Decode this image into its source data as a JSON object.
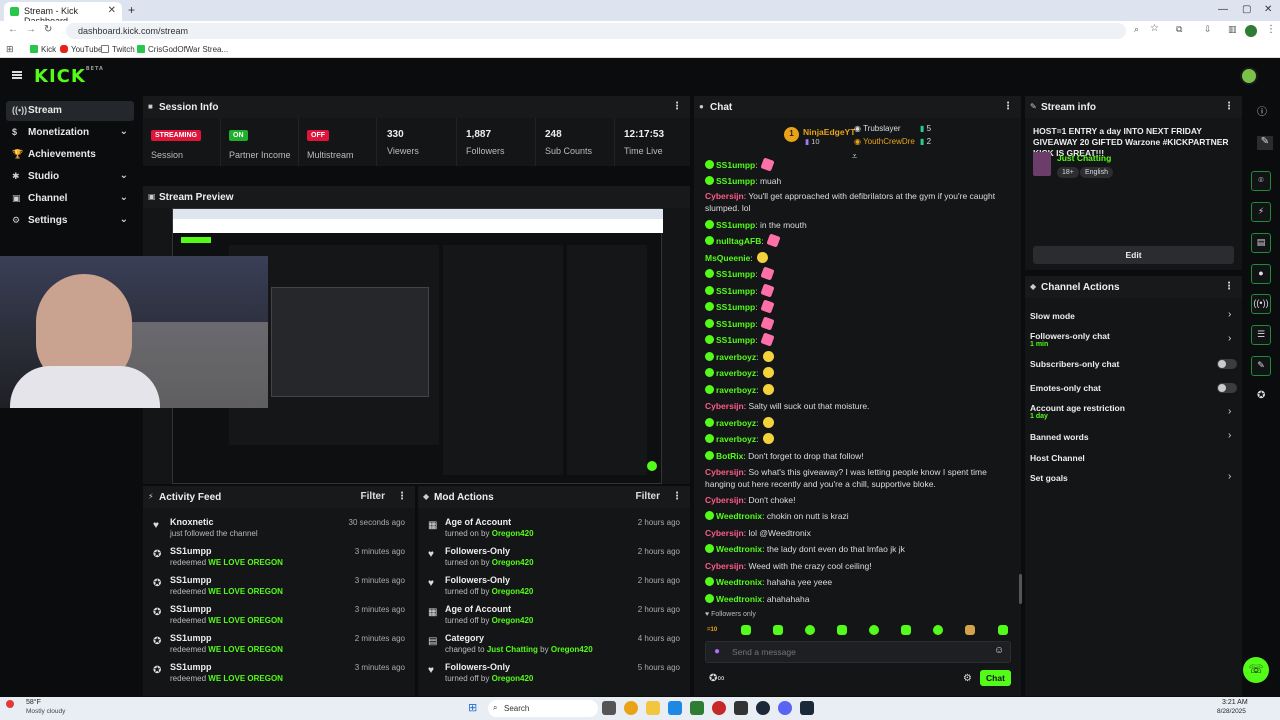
{
  "browser": {
    "tab_title": "Stream - Kick Dashboard",
    "new_tab": "+",
    "url": "dashboard.kick.com/stream",
    "bookmarks": [
      "Kick",
      "YouTube",
      "Twitch",
      "CrisGodOfWar Strea..."
    ]
  },
  "brand": {
    "logo": "KICK",
    "logo_sup": "BETA",
    "accent": "#53fc18"
  },
  "sidebar": {
    "items": [
      {
        "label": "Stream",
        "icon": "stream-icon",
        "active": true
      },
      {
        "label": "Monetization",
        "icon": "dollar-icon"
      },
      {
        "label": "Achievements",
        "icon": "trophy-icon"
      },
      {
        "label": "Studio",
        "icon": "studio-icon"
      },
      {
        "label": "Channel",
        "icon": "channel-icon"
      },
      {
        "label": "Settings",
        "icon": "gear-icon"
      }
    ]
  },
  "session": {
    "title": "Session Info",
    "stats": [
      {
        "badge": "STREAMING",
        "label": "Session",
        "color": "#e0133a"
      },
      {
        "badge": "ON",
        "label": "Partner Income",
        "color": "#1fae2e"
      },
      {
        "badge": "OFF",
        "label": "Multistream",
        "color": "#e0133a"
      },
      {
        "value": "330",
        "label": "Viewers"
      },
      {
        "value": "1,887",
        "label": "Followers"
      },
      {
        "value": "248",
        "label": "Sub Counts"
      },
      {
        "value": "12:17:53",
        "label": "Time Live"
      }
    ]
  },
  "preview": {
    "title": "Stream Preview"
  },
  "activity": {
    "title": "Activity Feed",
    "filter": "Filter",
    "rows": [
      {
        "user": "Knoxnetic",
        "detail": "just followed the channel",
        "time": "30 seconds ago",
        "icon": "heart-icon"
      },
      {
        "user": "SS1umpp",
        "detail_pre": "redeemed",
        "reward": "WE LOVE OREGON",
        "time": "3 minutes ago",
        "icon": "reward-icon"
      },
      {
        "user": "SS1umpp",
        "detail_pre": "redeemed",
        "reward": "WE LOVE OREGON",
        "time": "3 minutes ago",
        "icon": "reward-icon"
      },
      {
        "user": "SS1umpp",
        "detail_pre": "redeemed",
        "reward": "WE LOVE OREGON",
        "time": "3 minutes ago",
        "icon": "reward-icon"
      },
      {
        "user": "SS1umpp",
        "detail_pre": "redeemed",
        "reward": "WE LOVE OREGON",
        "time": "2 minutes ago",
        "icon": "reward-icon"
      },
      {
        "user": "SS1umpp",
        "detail_pre": "redeemed",
        "reward": "WE LOVE OREGON",
        "time": "3 minutes ago",
        "icon": "reward-icon"
      }
    ]
  },
  "mod": {
    "title": "Mod Actions",
    "filter": "Filter",
    "rows": [
      {
        "action": "Age of Account",
        "pre": "turned on by",
        "by": "Oregon420",
        "time": "2 hours ago",
        "icon": "calendar-icon"
      },
      {
        "action": "Followers-Only",
        "pre": "turned on by",
        "by": "Oregon420",
        "time": "2 hours ago",
        "icon": "heart-icon"
      },
      {
        "action": "Followers-Only",
        "pre": "turned off by",
        "by": "Oregon420",
        "time": "2 hours ago",
        "icon": "heart-icon"
      },
      {
        "action": "Age of Account",
        "pre": "turned off by",
        "by": "Oregon420",
        "time": "2 hours ago",
        "icon": "calendar-icon"
      },
      {
        "action": "Category",
        "pre": "changed to",
        "mid": "Just Chatting",
        "pre2": "by",
        "by": "Oregon420",
        "time": "4 hours ago",
        "icon": "category-icon"
      },
      {
        "action": "Followers-Only",
        "pre": "turned off by",
        "by": "Oregon420",
        "time": "5 hours ago",
        "icon": "heart-icon"
      }
    ]
  },
  "chat": {
    "title": "Chat",
    "top_gifter": {
      "name": "NinjaEdgeYT",
      "count": "10",
      "rank": "1"
    },
    "others": [
      {
        "name": "Trubslayer",
        "count": "5"
      },
      {
        "name": "YouthCrewDre",
        "count": "2"
      }
    ],
    "messages": [
      {
        "user": "SS1umpp",
        "text": "",
        "color": "#53fc18",
        "badge": true,
        "emote": "pink"
      },
      {
        "user": "SS1umpp",
        "text": "muah",
        "color": "#53fc18",
        "badge": true
      },
      {
        "user": "Cybersijn",
        "text": "You'll get approached with defibrilators at the gym if you're caught slumped. lol",
        "color": "#ff5c8a"
      },
      {
        "user": "SS1umpp",
        "text": "in the mouth",
        "color": "#53fc18",
        "badge": true
      },
      {
        "user": "nulltagAFB",
        "text": "",
        "color": "#53fc18",
        "badge": true,
        "emote": "pink"
      },
      {
        "user": "MsQueenie",
        "text": "",
        "color": "#53fc18",
        "emote": "y"
      },
      {
        "user": "SS1umpp",
        "text": "",
        "color": "#53fc18",
        "badge": true,
        "emote": "pink"
      },
      {
        "user": "SS1umpp",
        "text": "",
        "color": "#53fc18",
        "badge": true,
        "emote": "pink"
      },
      {
        "user": "SS1umpp",
        "text": "",
        "color": "#53fc18",
        "badge": true,
        "emote": "pink"
      },
      {
        "user": "SS1umpp",
        "text": "",
        "color": "#53fc18",
        "badge": true,
        "emote": "pink"
      },
      {
        "user": "SS1umpp",
        "text": "",
        "color": "#53fc18",
        "badge": true,
        "emote": "pink"
      },
      {
        "user": "raverboyz",
        "text": "",
        "color": "#53fc18",
        "badge": true,
        "emote": "y"
      },
      {
        "user": "raverboyz",
        "text": "",
        "color": "#53fc18",
        "badge": true,
        "emote": "y"
      },
      {
        "user": "raverboyz",
        "text": "",
        "color": "#53fc18",
        "badge": true,
        "emote": "y"
      },
      {
        "user": "Cybersijn",
        "text": "Salty will suck out that moisture.",
        "color": "#ff5c8a"
      },
      {
        "user": "raverboyz",
        "text": "",
        "color": "#53fc18",
        "badge": true,
        "emote": "y"
      },
      {
        "user": "raverboyz",
        "text": "",
        "color": "#53fc18",
        "badge": true,
        "emote": "y"
      },
      {
        "user": "BotRix",
        "text": "Don't forget to drop that follow!",
        "color": "#53fc18",
        "badge": true
      },
      {
        "user": "Cybersijn",
        "text": "So what's this giveaway? I was letting people know I spent time hanging out here recently and you're a chill, supportive bloke.",
        "color": "#ff5c8a"
      },
      {
        "user": "Cybersijn",
        "text": "Don't choke!",
        "color": "#ff5c8a"
      },
      {
        "user": "Weedtronix",
        "text": "chokin on nutt is krazi",
        "color": "#53fc18",
        "badge": true
      },
      {
        "user": "Cybersijn",
        "text": "lol @Weedtronix",
        "color": "#ff5c8a"
      },
      {
        "user": "Weedtronix",
        "text": "the lady dont even do that lmfao jk jk",
        "color": "#53fc18",
        "badge": true
      },
      {
        "user": "Cybersijn",
        "text": "Weed with the crazy cool ceiling!",
        "color": "#ff5c8a"
      },
      {
        "user": "Weedtronix",
        "text": "hahaha yee yeee",
        "color": "#53fc18",
        "badge": true
      },
      {
        "user": "Weedtronix",
        "text": "ahahahaha",
        "color": "#53fc18",
        "badge": true
      }
    ],
    "followers_only": "Followers only",
    "placeholder": "Send a message",
    "send": "Chat"
  },
  "stream_info": {
    "title": "Stream info",
    "stream_title": "HOST=1 ENTRY a day INTO NEXT FRIDAY GIVEAWAY 20 GIFTED Warzone #KICKPARTNER KICK IS GREAT!!!",
    "category": "Just Chatting",
    "tags": [
      "18+",
      "English"
    ],
    "edit": "Edit"
  },
  "channel_actions": {
    "title": "Channel Actions",
    "items": [
      {
        "label": "Slow mode",
        "kind": "chevron"
      },
      {
        "label": "Followers-only chat",
        "sub": "1 min",
        "kind": "chevron"
      },
      {
        "label": "Subscribers-only chat",
        "kind": "toggle"
      },
      {
        "label": "Emotes-only chat",
        "kind": "toggle"
      },
      {
        "label": "Account age restriction",
        "sub": "1 day",
        "kind": "chevron"
      },
      {
        "label": "Banned words",
        "kind": "chevron"
      },
      {
        "label": "Host Channel",
        "kind": "none"
      },
      {
        "label": "Set goals",
        "kind": "chevron"
      }
    ]
  },
  "taskbar": {
    "weather_temp": "58°F",
    "weather_desc": "Mostly cloudy",
    "search": "Search",
    "time": "3:21 AM",
    "date": "8/28/2025"
  }
}
